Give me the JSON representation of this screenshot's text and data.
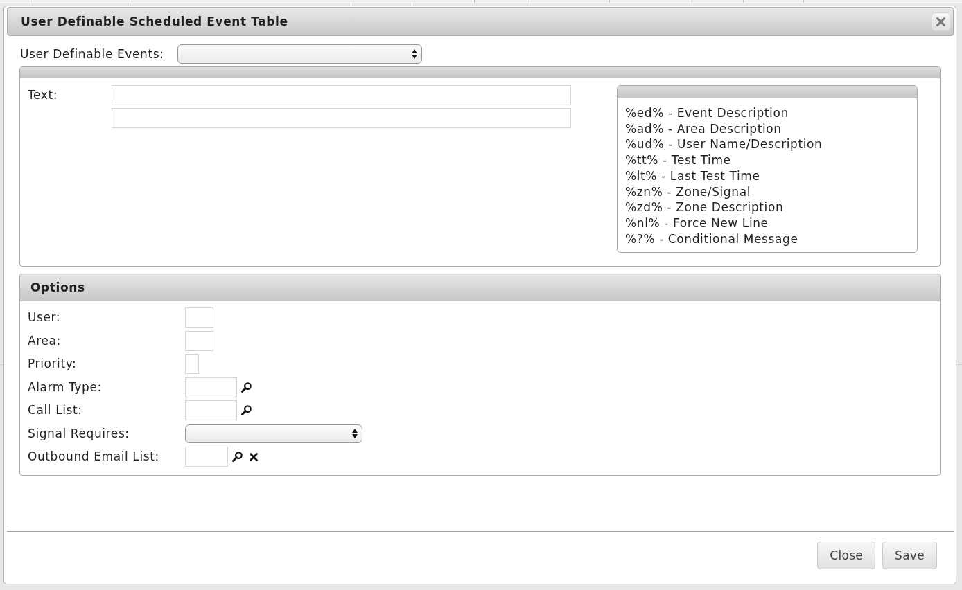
{
  "dialog": {
    "title": "User Definable Scheduled Event Table",
    "events": {
      "label": "User Definable Events:"
    },
    "text_panel": {
      "label": "Text:",
      "fields": [
        {
          "kind": "input"
        },
        {
          "kind": "input"
        }
      ],
      "legend_items": [
        "%ed% - Event Description",
        "%ad% - Area Description",
        "%ud% - User Name/Description",
        "%tt% - Test Time",
        "%lt% - Last Test Time",
        "%zn% - Zone/Signal",
        "%zd% - Zone Description",
        "%nl% - Force New Line",
        "%?% - Conditional Message"
      ]
    },
    "options": {
      "title": "Options",
      "rows": [
        {
          "label": "User:",
          "kind": "input"
        },
        {
          "label": "Area:",
          "kind": "input"
        },
        {
          "label": "Priority:",
          "kind": "narrow_input"
        },
        {
          "label": "Alarm Type:",
          "kind": "lookup"
        },
        {
          "label": "Call List:",
          "kind": "lookup"
        },
        {
          "label": "Signal Requires:",
          "kind": "select"
        },
        {
          "label": "Outbound Email List:",
          "kind": "lookup_clear"
        }
      ]
    },
    "buttons": [
      "Close",
      "Save"
    ]
  }
}
